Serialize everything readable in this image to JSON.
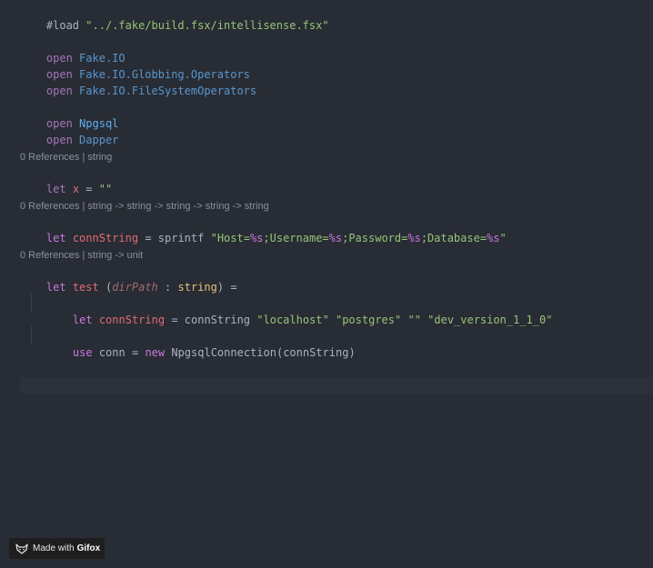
{
  "lines": {
    "load": {
      "directive": "#load",
      "path": "\"../.fake/build.fsx/intellisense.fsx\""
    },
    "open1": {
      "kw": "open",
      "ns": "Fake.IO"
    },
    "open2": {
      "kw": "open",
      "ns": "Fake.IO.Globbing.Operators"
    },
    "open3": {
      "kw": "open",
      "ns": "Fake.IO.FileSystemOperators"
    },
    "open4": {
      "kw": "open",
      "ns": "Npgsql"
    },
    "open5": {
      "kw": "open",
      "ns": "Dapper"
    },
    "lens1": "0 References | string",
    "let_x": {
      "kw": "let",
      "name": "x",
      "eq": "=",
      "value": "\"\""
    },
    "lens2": "0 References | string -> string -> string -> string -> string",
    "let_conn": {
      "kw": "let",
      "name": "connString",
      "eq": "=",
      "func": "sprintf",
      "q_open": "\"Host=",
      "f1": "%s",
      "s1": ";Username=",
      "f2": "%s",
      "s2": ";Password=",
      "f3": "%s",
      "s3": ";Database=",
      "f4": "%s",
      "q_close": "\""
    },
    "lens3": "0 References | string -> unit",
    "let_test": {
      "kw": "let",
      "name": "test",
      "paren_open": "(",
      "param": "dirPath",
      "colon": ":",
      "type": "string",
      "paren_close": ")",
      "eq": "="
    },
    "inner_let": {
      "kw": "let",
      "name": "connString",
      "eq": "=",
      "call": "connString",
      "a1": "\"localhost\"",
      "a2": "\"postgres\"",
      "a3": "\"\"",
      "a4": "\"dev_version_1_1_0\""
    },
    "use_line": {
      "kw": "use",
      "name": "conn",
      "eq": "=",
      "new_kw": "new",
      "ctor": "NpgsqlConnection",
      "paren_open": "(",
      "arg": "connString",
      "paren_close": ")"
    }
  },
  "badge": {
    "prefix": "Made with",
    "brand": "Gifox"
  },
  "colors": {
    "background": "#282c34",
    "keyword": "#c678dd",
    "namespace": "#5a97cf",
    "string": "#98c379",
    "variable": "#e06c75",
    "type": "#e5c07b"
  }
}
